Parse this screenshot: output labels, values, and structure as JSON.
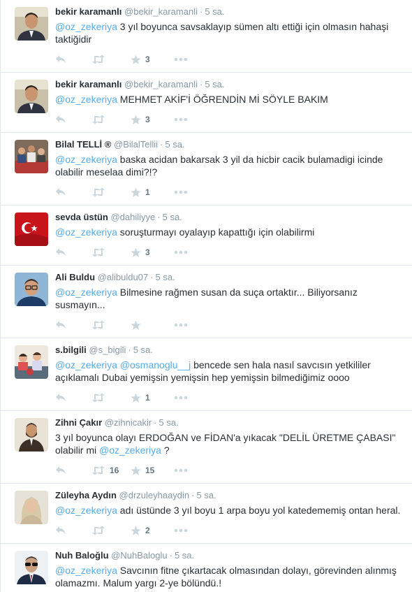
{
  "tweets": [
    {
      "name": "bekir karamanlı",
      "handle": "@bekir_karamanli",
      "time": "5 sa.",
      "parts": [
        {
          "t": "@oz_zekeriya",
          "m": true
        },
        {
          "t": " 3 yıl boyunca savsaklayıp sümen altı ettiği için olmasın hahaşi taktiğidir",
          "m": false
        }
      ],
      "retweets": "",
      "favorites": "3",
      "avatar": "man-suit"
    },
    {
      "name": "bekir karamanlı",
      "handle": "@bekir_karamanli",
      "time": "5 sa.",
      "parts": [
        {
          "t": "@oz_zekeriya",
          "m": true
        },
        {
          "t": " MEHMET AKİF'İ ÖĞRENDİN Mİ SÖYLE BAKIM",
          "m": false
        }
      ],
      "retweets": "",
      "favorites": "3",
      "avatar": "man-suit"
    },
    {
      "name": "Bilal TELLİ ®",
      "handle": "@BilalTellii",
      "time": "5 sa.",
      "parts": [
        {
          "t": "@oz_zekeriya",
          "m": true
        },
        {
          "t": " baska acidan bakarsak 3 yil da hicbir cacik bulamadigi icinde olabilir meselaa dimi?!?",
          "m": false
        }
      ],
      "retweets": "",
      "favorites": "1",
      "avatar": "crowd"
    },
    {
      "name": "sevda üstün",
      "handle": "@dahiliyye",
      "time": "5 sa.",
      "parts": [
        {
          "t": "@oz_zekeriya",
          "m": true
        },
        {
          "t": " soruşturmayı oyalayıp kapattığı için olabilirmi",
          "m": false
        }
      ],
      "retweets": "",
      "favorites": "3",
      "avatar": "flag"
    },
    {
      "name": "Ali Buldu",
      "handle": "@alibuldu07",
      "time": "5 sa.",
      "parts": [
        {
          "t": "@oz_zekeriya",
          "m": true
        },
        {
          "t": " Bilmesine rağmen susan da suça ortaktır... Biliyorsanız susmayın...",
          "m": false
        }
      ],
      "retweets": "",
      "favorites": "",
      "avatar": "man-glasses"
    },
    {
      "name": "s.bilgili",
      "handle": "@s_bigili",
      "time": "5 sa.",
      "parts": [
        {
          "t": "@oz_zekeriya",
          "m": true
        },
        {
          "t": " ",
          "m": false
        },
        {
          "t": "@osmanoglu__j",
          "m": true
        },
        {
          "t": " bencede sen hala nasıl savcısın yetkililer açıklamalı Dubai yemişsin yemişsin hep yemişsin bilmediğimiz oooo",
          "m": false
        }
      ],
      "retweets": "",
      "favorites": "1",
      "avatar": "kids"
    },
    {
      "name": "Zihni Çakır",
      "handle": "@zihnicakir",
      "time": "5 sa.",
      "parts": [
        {
          "t": "3 yıl boyunca olayı ERDOĞAN ve FİDAN'a yıkacak \"DELİL ÜRETME ÇABASI\" olabilir mi ",
          "m": false
        },
        {
          "t": "@oz_zekeriya",
          "m": true
        },
        {
          "t": " ?",
          "m": false
        }
      ],
      "retweets": "16",
      "favorites": "15",
      "avatar": "man-beard"
    },
    {
      "name": "Züleyha Aydın",
      "handle": "@drzuleyhaaydin",
      "time": "5 sa.",
      "parts": [
        {
          "t": "@oz_zekeriya",
          "m": true
        },
        {
          "t": " adı üstünde 3 yıl boyu 1 arpa boyu yol katedememiş ontan heral.",
          "m": false
        }
      ],
      "retweets": "",
      "favorites": "2",
      "avatar": "woman"
    },
    {
      "name": "Nuh Baloğlu",
      "handle": "@NuhBaloglu",
      "time": "5 sa.",
      "parts": [
        {
          "t": "@oz_zekeriya",
          "m": true
        },
        {
          "t": " Savcının fitne çıkartacak olmasından dolayı, görevinden alınmış olamazmı. Malum yargı 2-ye bölündü.!",
          "m": false
        }
      ],
      "retweets": "",
      "favorites": "",
      "avatar": "man-sunglasses"
    }
  ],
  "colors": {
    "mention": "#55acee",
    "muted": "#8899a6",
    "icon": "#ccd6dd"
  }
}
